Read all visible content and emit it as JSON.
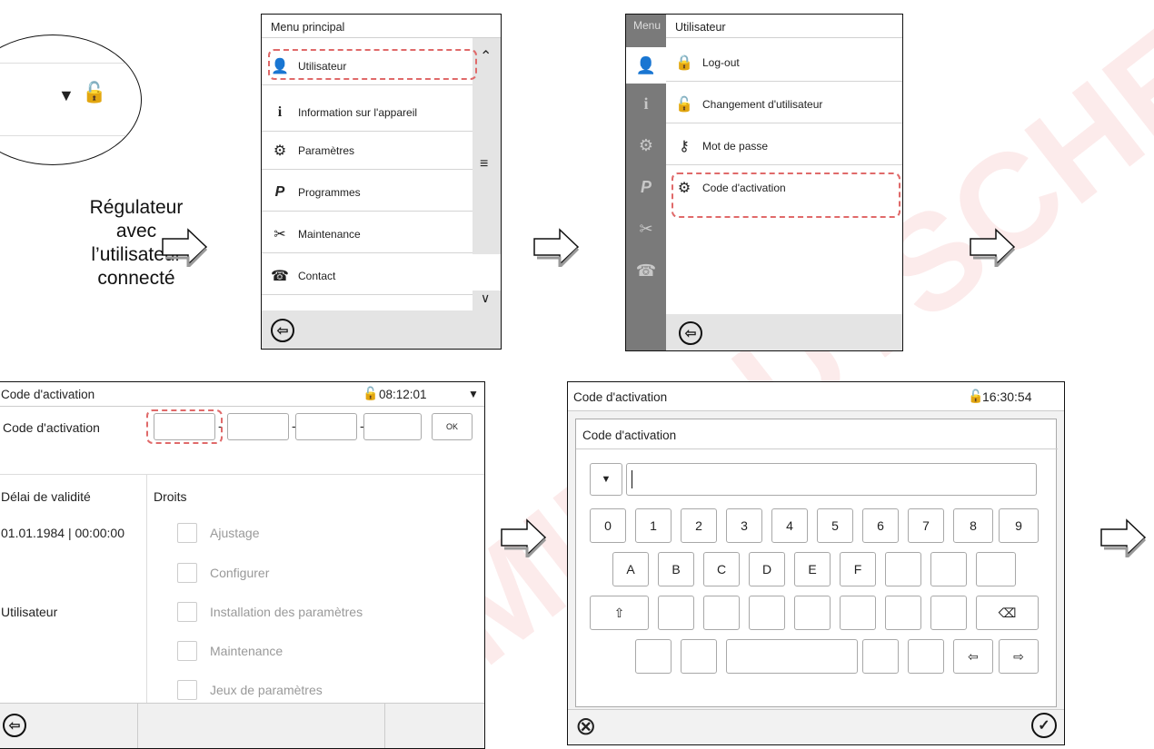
{
  "left_caption": [
    "Régulateur",
    "avec",
    "l’utilisateur",
    "connecté"
  ],
  "main_menu": {
    "title": "Menu principal",
    "items": [
      {
        "label": "Utilisateur",
        "icon": "user-icon"
      },
      {
        "label": "Information sur l'appareil",
        "icon": "info-icon"
      },
      {
        "label": "Paramètres",
        "icon": "settings-icon"
      },
      {
        "label": "Programmes",
        "icon": "programs-icon"
      },
      {
        "label": "Maintenance",
        "icon": "maintenance-icon"
      },
      {
        "label": "Contact",
        "icon": "contact-icon"
      }
    ]
  },
  "user_menu": {
    "title_left": "Menu",
    "title": "Utilisateur",
    "items": [
      {
        "label": "Log-out",
        "icon": "lock-icon"
      },
      {
        "label": "Changement d'utilisateur",
        "icon": "change-user-icon"
      },
      {
        "label": "Mot de passe",
        "icon": "password-icon"
      },
      {
        "label": "Code d'activation",
        "icon": "activation-code-icon"
      }
    ]
  },
  "activation_screen": {
    "title": "Code d'activation",
    "time": "08:12:01",
    "code_label": "Code d'activation",
    "ok_label": "OK",
    "validity_label": "Délai de validité",
    "rights_label": "Droits",
    "validity_value": "01.01.1984 | 00:00:00",
    "user_label": "Utilisateur",
    "rights": [
      "Ajustage",
      "Configurer",
      "Installation des paramètres",
      "Maintenance",
      "Jeux de paramètres"
    ]
  },
  "keyboard_screen": {
    "title": "Code d'activation",
    "time": "16:30:54",
    "dialog_title": "Code d'activation",
    "digit_keys": [
      "0",
      "1",
      "2",
      "3",
      "4",
      "5",
      "6",
      "7",
      "8",
      "9"
    ],
    "letter_keys": [
      "A",
      "B",
      "C",
      "D",
      "E",
      "F"
    ],
    "shift_symbol": "⇧",
    "backspace_symbol": "⌫",
    "left_symbol": "⇦",
    "right_symbol": "⇨",
    "cancel_symbol": "⊗",
    "confirm_symbol": "✓"
  },
  "watermark": "MIE DUTSCHER"
}
